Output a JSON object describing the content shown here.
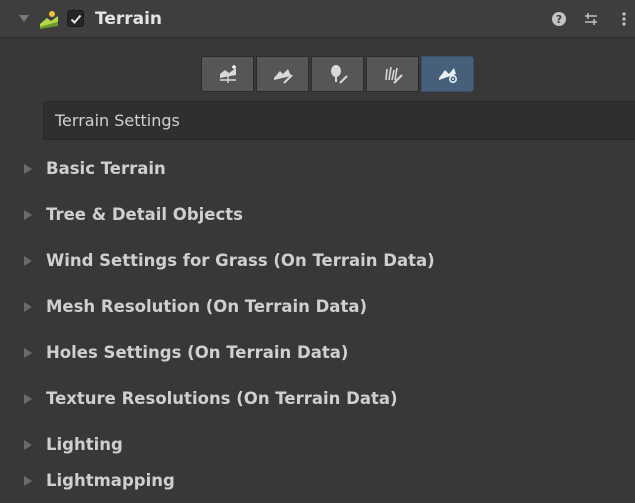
{
  "header": {
    "title": "Terrain",
    "enabled": true,
    "icons": [
      "foldout-arrow-icon",
      "terrain-icon",
      "help-icon",
      "preset-icon",
      "more-options-icon"
    ]
  },
  "toolbar": {
    "tools": [
      {
        "name": "create-neighbor-terrains-icon"
      },
      {
        "name": "paint-terrain-icon"
      },
      {
        "name": "paint-trees-icon"
      },
      {
        "name": "paint-details-icon"
      },
      {
        "name": "terrain-settings-icon",
        "selected": true
      }
    ]
  },
  "panel": {
    "settings_label": "Terrain Settings"
  },
  "sections": [
    {
      "label": "Basic Terrain"
    },
    {
      "label": "Tree & Detail Objects"
    },
    {
      "label": "Wind Settings for Grass (On Terrain Data)"
    },
    {
      "label": "Mesh Resolution (On Terrain Data)"
    },
    {
      "label": "Holes Settings (On Terrain Data)"
    },
    {
      "label": "Texture Resolutions (On Terrain Data)"
    },
    {
      "label": "Lighting"
    },
    {
      "label": "Lightmapping"
    }
  ],
  "colors": {
    "background": "#383838",
    "header": "#3e3e3e",
    "active_tool": "#46607c",
    "text": "#cfcfcf"
  }
}
